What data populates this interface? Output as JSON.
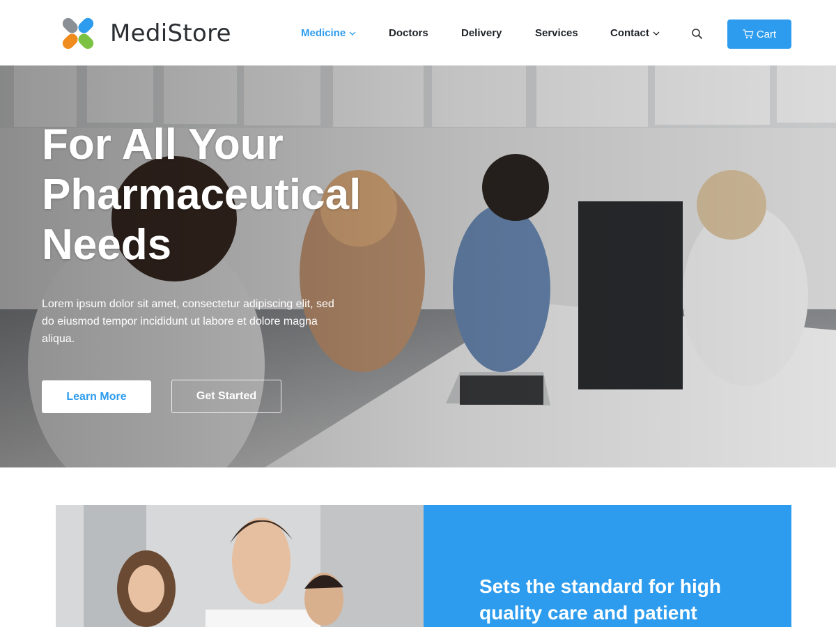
{
  "brand": {
    "name": "MediStore"
  },
  "nav": {
    "items": [
      {
        "label": "Medicine",
        "active": true,
        "has_dropdown": true
      },
      {
        "label": "Doctors",
        "active": false,
        "has_dropdown": false
      },
      {
        "label": "Delivery",
        "active": false,
        "has_dropdown": false
      },
      {
        "label": "Services",
        "active": false,
        "has_dropdown": false
      },
      {
        "label": "Contact",
        "active": false,
        "has_dropdown": true
      }
    ],
    "search_icon": "search-icon",
    "cart_label": "Cart",
    "cart_icon": "cart-icon"
  },
  "hero": {
    "title_lines": [
      "For All Your",
      "Pharmaceutical",
      "Needs"
    ],
    "body": "Lorem ipsum dolor sit amet, consectetur adipiscing elit, sed do eiusmod tempor incididunt ut labore et dolore magna aliqua.",
    "primary_button": "Learn More",
    "secondary_button": "Get Started"
  },
  "feature": {
    "heading": "Sets the standard for high quality care and patient"
  },
  "colors": {
    "accent": "#2d9cee",
    "text_dark": "#1f2328",
    "white": "#ffffff"
  }
}
